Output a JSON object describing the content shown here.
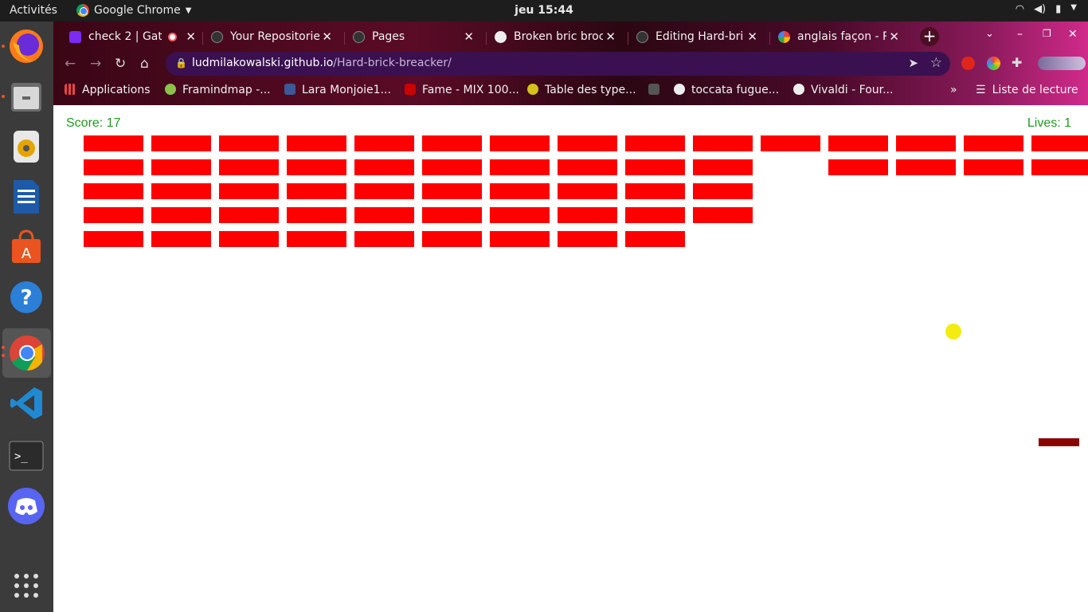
{
  "topbar": {
    "activities": "Activités",
    "app_name": "Google Chrome",
    "clock": "jeu 15:44"
  },
  "dock": {
    "apps": [
      "firefox-icon",
      "files-icon",
      "rhythmbox-icon",
      "libreoffice-writer-icon",
      "software-center-icon",
      "help-icon",
      "chrome-icon",
      "vscode-icon",
      "terminal-icon",
      "discord-icon",
      "show-apps-icon"
    ]
  },
  "tabs": [
    {
      "title": "check 2 | Gath",
      "favicon_color": "#7b2cf0"
    },
    {
      "title": "Your Repositorie",
      "favicon_color": "#333333"
    },
    {
      "title": "Pages",
      "favicon_color": "#333333"
    },
    {
      "title": "Broken bric broc",
      "favicon_color": "#eeeeee"
    },
    {
      "title": "Editing Hard-bri",
      "favicon_color": "#333333"
    },
    {
      "title": "anglais façon - R",
      "favicon_color": "#4285f4"
    }
  ],
  "address_bar": {
    "host": "ludmilakowalski.github.io",
    "path": "/Hard-brick-breacker/"
  },
  "bookmarks": [
    {
      "label": "Applications",
      "color": "#e44"
    },
    {
      "label": "Framindmap -...",
      "color": "#8bc34a"
    },
    {
      "label": "Lara Monjoie1...",
      "color": "#3b5998"
    },
    {
      "label": "Fame - MIX 100...",
      "color": "#c00"
    },
    {
      "label": "Table des type...",
      "color": "#d4c21a"
    },
    {
      "label": "",
      "color": "#555"
    },
    {
      "label": "toccata fugue...",
      "color": "#eee"
    },
    {
      "label": "Vivaldi - Four...",
      "color": "#eee"
    }
  ],
  "reading_list": "Liste de lecture",
  "game": {
    "score_text": "Score: 17",
    "lives_text": "Lives: 1",
    "brick_color": "#ff0000",
    "ball_color": "#f4ec10",
    "paddle_color": "#8b0000",
    "text_color": "#1d9a20",
    "brick_grid": [
      [
        1,
        1,
        1,
        1,
        1,
        1,
        1,
        1,
        1,
        1,
        1,
        1,
        1,
        1,
        1
      ],
      [
        1,
        1,
        1,
        1,
        1,
        1,
        1,
        1,
        1,
        1,
        0,
        1,
        1,
        1,
        1
      ],
      [
        1,
        1,
        1,
        1,
        1,
        1,
        1,
        1,
        1,
        1,
        0,
        0,
        0,
        0,
        0
      ],
      [
        1,
        1,
        1,
        1,
        1,
        1,
        1,
        1,
        1,
        1,
        0,
        0,
        0,
        0,
        0
      ],
      [
        1,
        1,
        1,
        1,
        1,
        1,
        1,
        1,
        1,
        0,
        0,
        0,
        0,
        0,
        0
      ]
    ]
  }
}
